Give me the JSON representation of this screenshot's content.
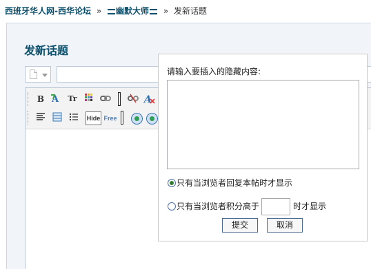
{
  "breadcrumb": {
    "forum": "西班牙华人网-西华论坛",
    "separator": "»",
    "user": "幽默大师",
    "current": "发新话题"
  },
  "page": {
    "title": "发新话题"
  },
  "toolbar": {
    "bold": "B",
    "font_size": "Tr",
    "hide": "Hide",
    "free": "Free"
  },
  "popup": {
    "label": "请输入要插入的隐藏内容:",
    "textarea_value": "",
    "option_reply": "只有当浏览者回复本帖时才显示",
    "option_score_prefix": "只有当浏览者积分高于",
    "option_score_suffix": "时才显示",
    "score_value": "",
    "selected_option": "reply",
    "submit": "提交",
    "cancel": "取消"
  },
  "colors": {
    "link": "#0b4f6c",
    "panel_bg": "#f1f5fa"
  }
}
